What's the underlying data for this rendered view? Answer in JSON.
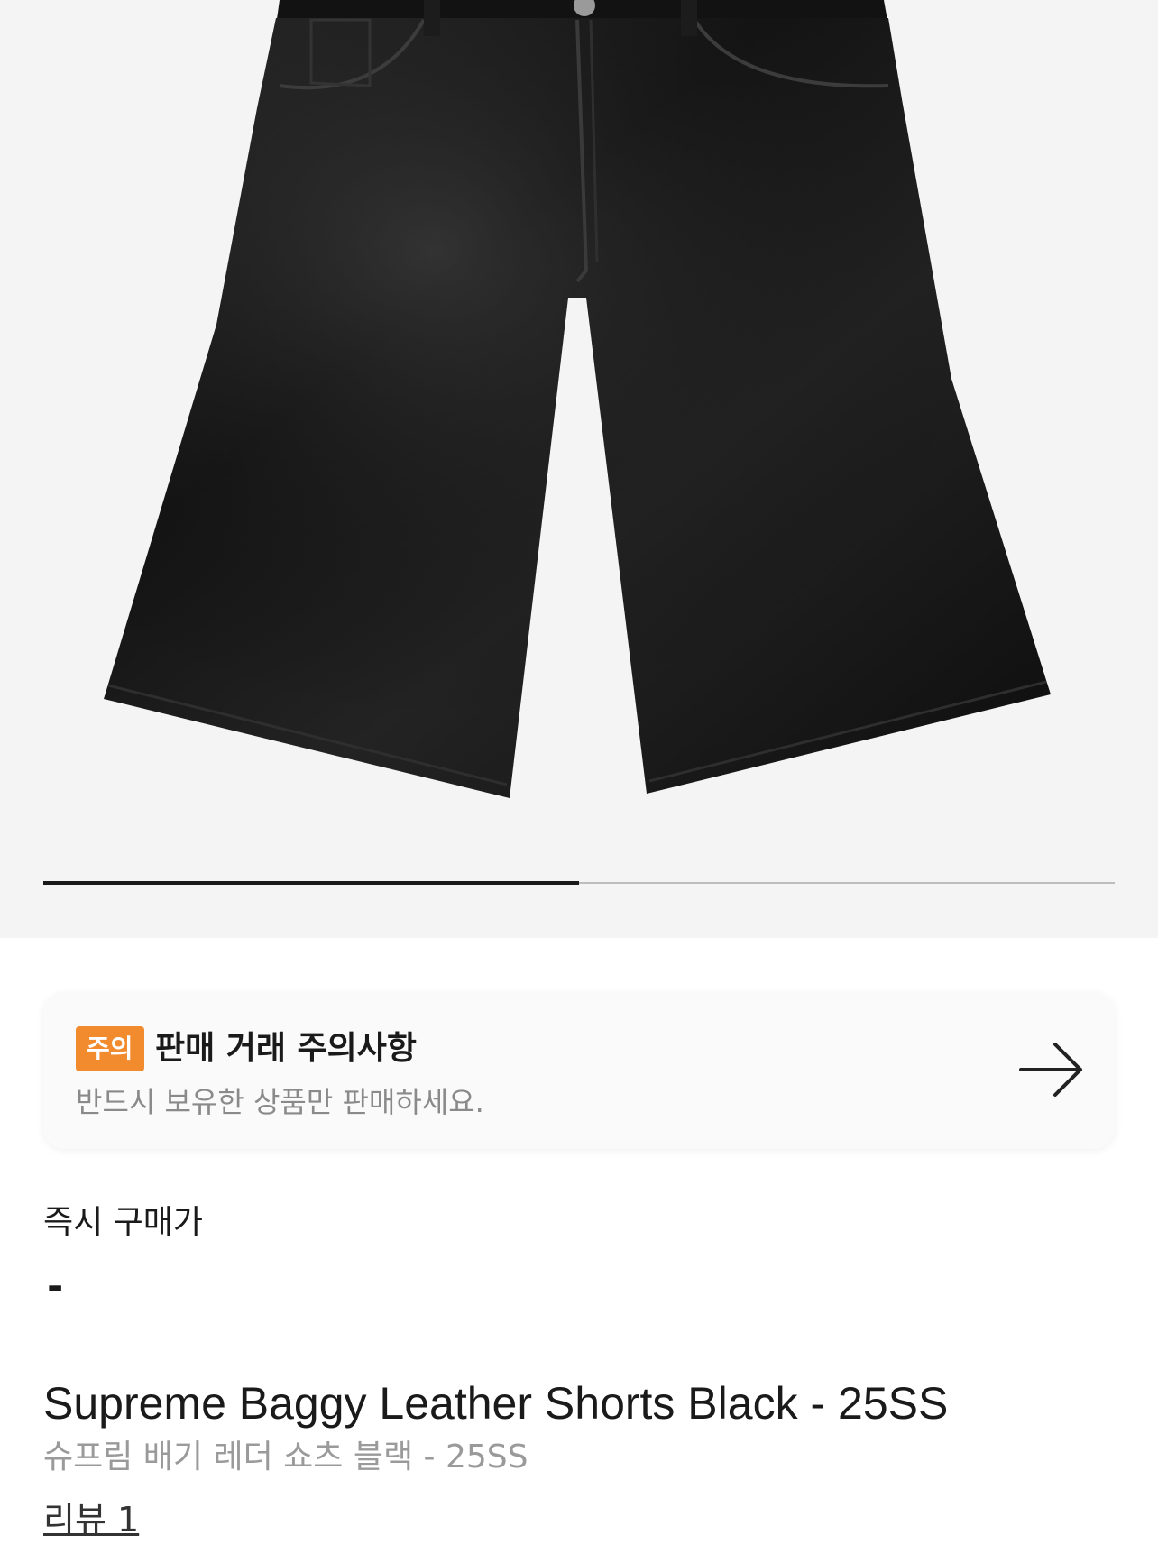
{
  "gallery": {
    "image_alt": "Supreme Baggy Leather Shorts Black",
    "pager": {
      "current": 1,
      "total": 2
    }
  },
  "notice": {
    "badge": "주의",
    "title": "판매 거래 주의사항",
    "description": "반드시 보유한 상품만 판매하세요.",
    "icon": "arrow-right-icon"
  },
  "price": {
    "label": "즉시 구매가",
    "value": "-"
  },
  "product": {
    "title": "Supreme Baggy Leather Shorts Black - 25SS",
    "subtitle": "슈프림 배기 레더 쇼츠 블랙 - 25SS"
  },
  "review": {
    "label": "리뷰 1"
  },
  "colors": {
    "badge": "#f28a2e",
    "gallery_bg": "#f4f4f4",
    "muted_text": "#8a8a8a"
  }
}
